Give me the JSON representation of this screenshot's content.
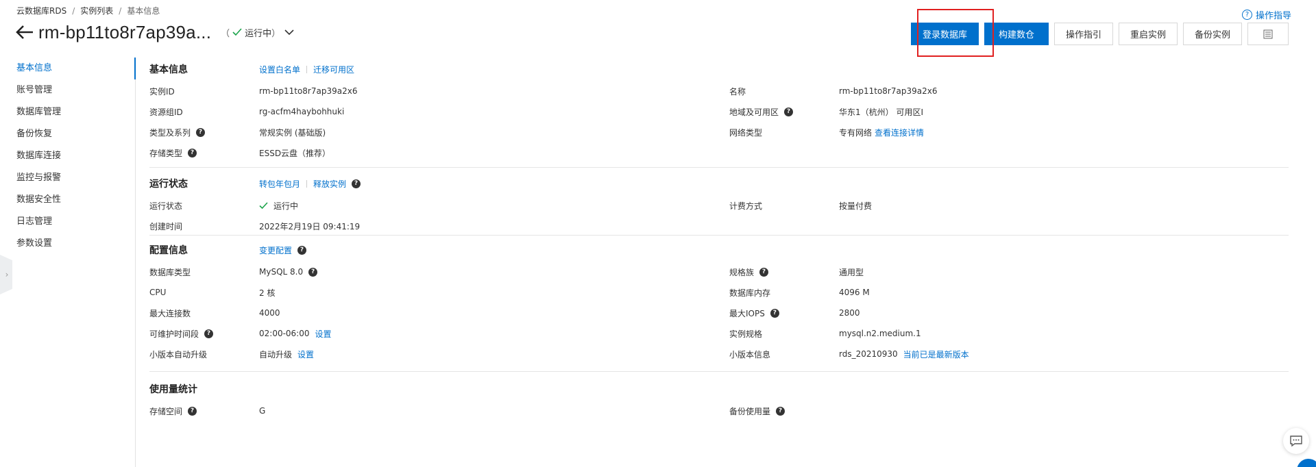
{
  "breadcrumb": [
    "云数据库RDS",
    "实例列表",
    "基本信息"
  ],
  "header": {
    "title": "rm-bp11to8r7ap39a...",
    "status_open": "（",
    "status": "运行中",
    "status_close": "）",
    "help_label": "操作指导"
  },
  "toolbar": {
    "login_db": "登录数据库",
    "build_mesh": "构建数仓",
    "guide": "操作指引",
    "restart": "重启实例",
    "backup": "备份实例"
  },
  "sidebar": {
    "items": [
      "基本信息",
      "账号管理",
      "数据库管理",
      "备份恢复",
      "数据库连接",
      "监控与报警",
      "数据安全性",
      "日志管理",
      "参数设置"
    ]
  },
  "sections": {
    "basic": {
      "title": "基本信息",
      "link_whitelist": "设置白名单",
      "link_migrate": "迁移可用区",
      "rows": [
        {
          "l": "实例ID",
          "v": "rm-bp11to8r7ap39a2x6",
          "l2": "名称",
          "v2": "rm-bp11to8r7ap39a2x6"
        },
        {
          "l": "资源组ID",
          "v": "rg-acfm4haybohhuki",
          "l2": "地域及可用区",
          "v2": "华东1（杭州） 可用区I"
        },
        {
          "l": "类型及系列",
          "v": "常规实例 (基础版)",
          "l2": "网络类型",
          "v2": "专有网络",
          "v2_link": "查看连接详情"
        },
        {
          "l": "存储类型",
          "v": "ESSD云盘（推荐）"
        }
      ]
    },
    "running": {
      "title": "运行状态",
      "link_convert": "转包年包月",
      "link_release": "释放实例",
      "rows": [
        {
          "l": "运行状态",
          "v": "运行中",
          "l2": "计费方式",
          "v2": "按量付费"
        },
        {
          "l": "创建时间",
          "v": "2022年2月19日 09:41:19"
        }
      ]
    },
    "config": {
      "title": "配置信息",
      "link_change": "变更配置",
      "rows": [
        {
          "l": "数据库类型",
          "v": "MySQL  8.0",
          "l2": "规格族",
          "v2": "通用型"
        },
        {
          "l": "CPU",
          "v": "2 核",
          "l2": "数据库内存",
          "v2": "4096 M"
        },
        {
          "l": "最大连接数",
          "v": "4000",
          "l2": "最大IOPS",
          "v2": "2800"
        },
        {
          "l": "可维护时间段",
          "v": "02:00-06:00",
          "v_link": "设置",
          "l2": "实例规格",
          "v2": "mysql.n2.medium.1"
        },
        {
          "l": "小版本自动升级",
          "v": "自动升级",
          "v_link": "设置",
          "l2": "小版本信息",
          "v2": "rds_20210930",
          "v2_link": "当前已是最新版本"
        }
      ]
    },
    "usage": {
      "title": "使用量统计",
      "rows": [
        {
          "l": "存储空间",
          "v": "G",
          "l2": "备份使用量"
        }
      ]
    }
  },
  "colors": {
    "accent": "#0070cc",
    "success": "#1aa34a",
    "highlight": "#e02020"
  }
}
